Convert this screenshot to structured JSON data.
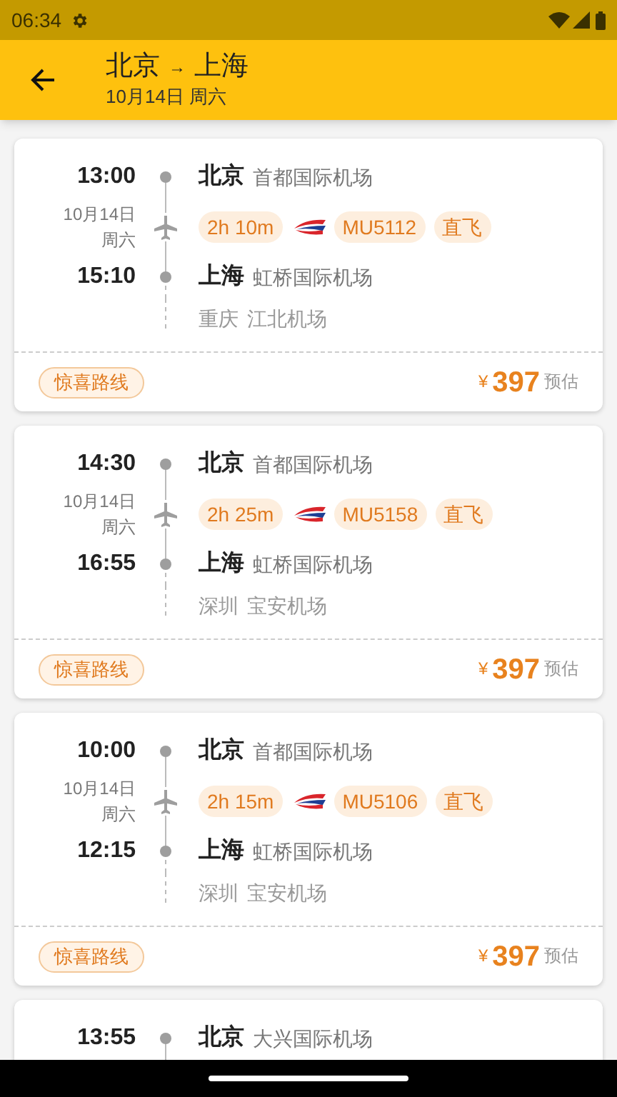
{
  "status_bar": {
    "time": "06:34"
  },
  "header": {
    "route_from": "北京",
    "arrow": "→",
    "route_to": "上海",
    "date": "10月14日 周六"
  },
  "flights": [
    {
      "depart_time": "13:00",
      "depart_city": "北京",
      "depart_airport": "首都国际机场",
      "date": "10月14日",
      "weekday": "周六",
      "duration": "2h 10m",
      "flight_no": "MU5112",
      "type": "直飞",
      "arrive_time": "15:10",
      "arrive_city": "上海",
      "arrive_airport": "虹桥国际机场",
      "via_city": "重庆",
      "via_airport": "江北机场",
      "tag": "惊喜路线",
      "currency": "¥",
      "price": "397",
      "price_note": "预估"
    },
    {
      "depart_time": "14:30",
      "depart_city": "北京",
      "depart_airport": "首都国际机场",
      "date": "10月14日",
      "weekday": "周六",
      "duration": "2h 25m",
      "flight_no": "MU5158",
      "type": "直飞",
      "arrive_time": "16:55",
      "arrive_city": "上海",
      "arrive_airport": "虹桥国际机场",
      "via_city": "深圳",
      "via_airport": "宝安机场",
      "tag": "惊喜路线",
      "currency": "¥",
      "price": "397",
      "price_note": "预估"
    },
    {
      "depart_time": "10:00",
      "depart_city": "北京",
      "depart_airport": "首都国际机场",
      "date": "10月14日",
      "weekday": "周六",
      "duration": "2h 15m",
      "flight_no": "MU5106",
      "type": "直飞",
      "arrive_time": "12:15",
      "arrive_city": "上海",
      "arrive_airport": "虹桥国际机场",
      "via_city": "深圳",
      "via_airport": "宝安机场",
      "tag": "惊喜路线",
      "currency": "¥",
      "price": "397",
      "price_note": "预估"
    },
    {
      "depart_time": "13:55",
      "depart_city": "北京",
      "depart_airport": "大兴国际机场"
    }
  ]
}
